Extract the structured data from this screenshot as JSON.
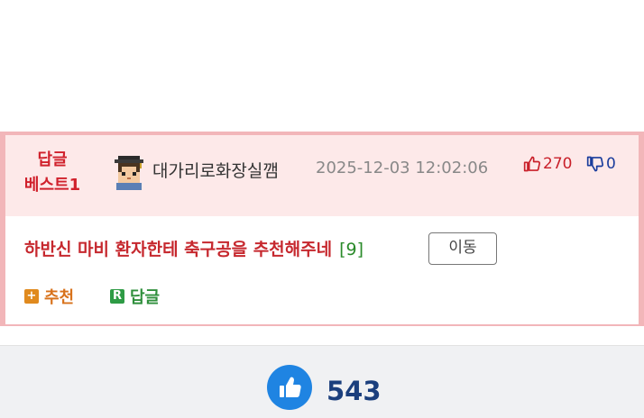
{
  "best": {
    "line1": "답글",
    "line2": "베스트1"
  },
  "post": {
    "author": "대가리로화장실깸",
    "timestamp": "2025-12-03 12:02:06",
    "upvotes": "270",
    "downvotes": "0",
    "title": "하반신 마비 환자한테 축구공을 추천해주네",
    "comment_count": "[9]",
    "move_label": "이동"
  },
  "actions": {
    "recommend": "추천",
    "reply": "답글",
    "recommend_icon": "+",
    "reply_icon": "R"
  },
  "footer": {
    "like_count": "543"
  },
  "colors": {
    "card_border": "#f2b6b9",
    "header_bg": "#fde9e9",
    "title_red": "#c6282e",
    "like_blue": "#1f84e2",
    "recommend_orange": "#e08a1e",
    "reply_green": "#2e9b45"
  }
}
